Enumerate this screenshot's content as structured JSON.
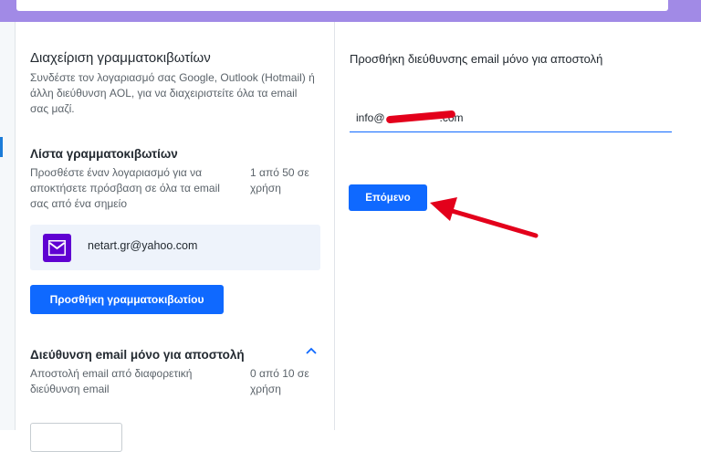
{
  "left_panel": {
    "title": "Διαχείριση γραμματοκιβωτίων",
    "description": "Συνδέστε τον λογαριασμό σας Google, Outlook (Hotmail) ή άλλη διεύθυνση AOL, για να διαχειριστείτε όλα τα email σας μαζί.",
    "mailbox_section": {
      "title": "Λίστα γραμματοκιβωτίων",
      "description": "Προσθέστε έναν λογαριασμό για να αποκτήσετε πρόσβαση σε όλα τα email σας από ένα σημείο",
      "count": "1 από 50 σε χρήση",
      "mailbox_email": "netart.gr@yahoo.com",
      "add_button_label": "Προσθήκη γραμματοκιβωτίου"
    },
    "sendonly_section": {
      "title": "Διεύθυνση email μόνο για αποστολή",
      "description": "Αποστολή email από διαφορετική διεύθυνση email",
      "count": "0 από 10 σε χρήση"
    }
  },
  "right_panel": {
    "title": "Προσθήκη διεύθυνσης email μόνο για αποστολή",
    "email_value": "info@                  .com",
    "next_button_label": "Επόμενο"
  },
  "colors": {
    "accent": "#0f69ff",
    "brand_purple": "#6001d2",
    "top_bar": "#a18ae6",
    "annotation_red": "#e3001b"
  },
  "icons": [
    "mail-icon",
    "chevron-up-icon",
    "arrow-annotation"
  ]
}
